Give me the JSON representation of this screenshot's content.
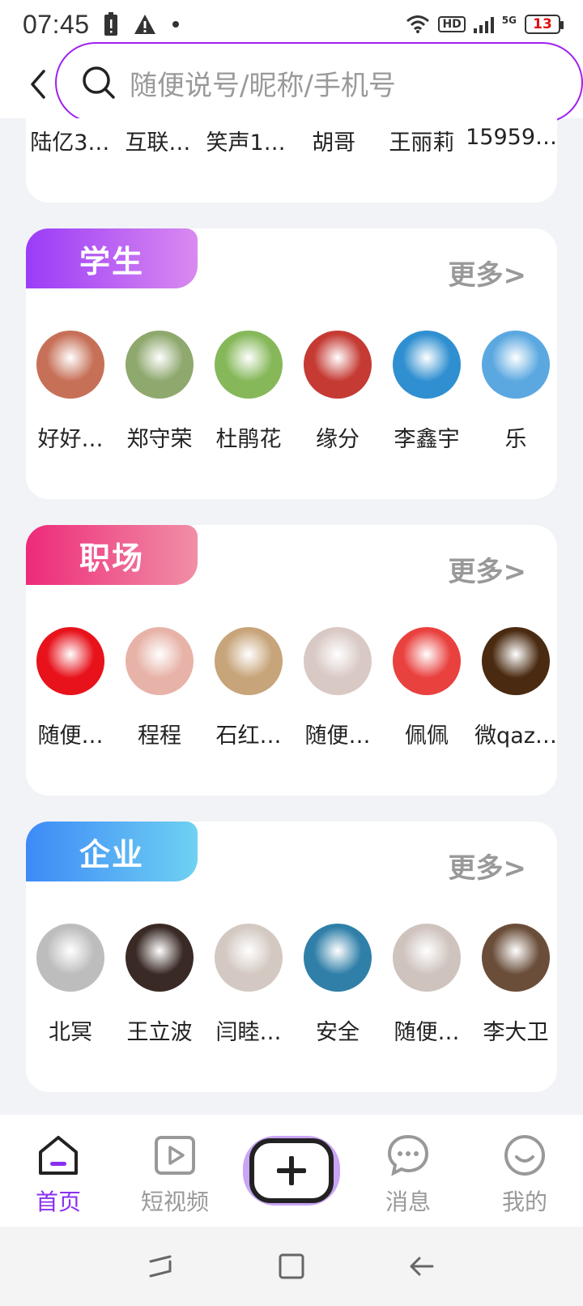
{
  "status_bar": {
    "time": "07:45",
    "battery": "13",
    "hd": "HD",
    "network": "5G"
  },
  "search": {
    "placeholder": "随便说号/昵称/手机号"
  },
  "top_card": {
    "names": [
      "陆亿3…",
      "互联…",
      "笑声1…",
      "胡哥",
      "王丽莉",
      "15959…"
    ]
  },
  "sections": [
    {
      "tag": "学生",
      "more": "更多>",
      "users": [
        {
          "name": "好好…",
          "avatar_color": "#c77058"
        },
        {
          "name": "郑守荣",
          "avatar_color": "#8fa86e"
        },
        {
          "name": "杜鹃花",
          "avatar_color": "#86b85a"
        },
        {
          "name": "缘分",
          "avatar_color": "#c53a33"
        },
        {
          "name": "李鑫宇",
          "avatar_color": "#2f8fd0"
        },
        {
          "name": "乐",
          "avatar_color": "#5ba8e0"
        }
      ]
    },
    {
      "tag": "职场",
      "more": "更多>",
      "users": [
        {
          "name": "随便…",
          "avatar_color": "#e8121b"
        },
        {
          "name": "程程",
          "avatar_color": "#e7b3a8"
        },
        {
          "name": "石红…",
          "avatar_color": "#c7a47a"
        },
        {
          "name": "随便…",
          "avatar_color": "#d9c9c4"
        },
        {
          "name": "佩佩",
          "avatar_color": "#e9413e"
        },
        {
          "name": "微qaz…",
          "avatar_color": "#4a2a10"
        }
      ]
    },
    {
      "tag": "企业",
      "more": "更多>",
      "users": [
        {
          "name": "北冥",
          "avatar_color": "#bdbdbd"
        },
        {
          "name": "王立波",
          "avatar_color": "#3a2a26"
        },
        {
          "name": "闫睦…",
          "avatar_color": "#d4c9c2"
        },
        {
          "name": "安全",
          "avatar_color": "#2f7fa8"
        },
        {
          "name": "随便…",
          "avatar_color": "#cfc3be"
        },
        {
          "name": "李大卫",
          "avatar_color": "#6a4e3a"
        }
      ]
    }
  ],
  "bottom_nav": {
    "home": "首页",
    "video": "短视频",
    "messages": "消息",
    "mine": "我的"
  },
  "colors": {
    "accent": "#8a2ff0",
    "search_border": "#a020f0"
  }
}
